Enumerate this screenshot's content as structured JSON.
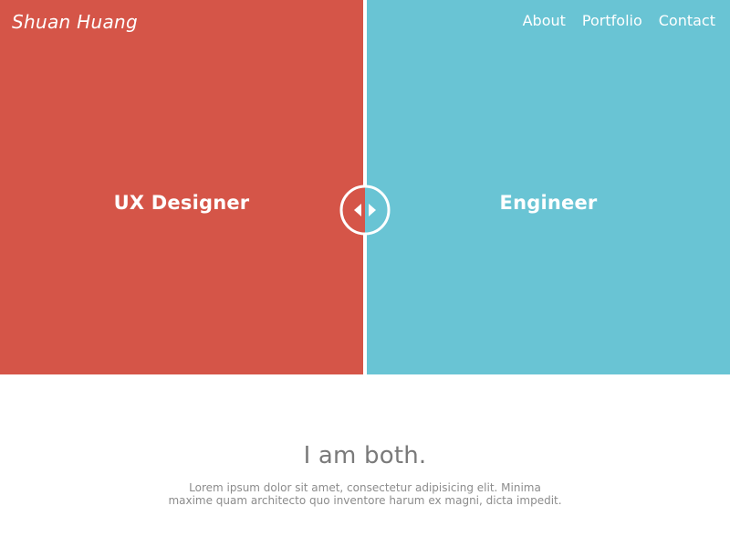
{
  "header": {
    "brand": "Shuan Huang",
    "nav": {
      "about": "About",
      "portfolio": "Portfolio",
      "contact": "Contact"
    }
  },
  "hero": {
    "left_title": "UX Designer",
    "right_title": "Engineer",
    "left_color": "#d55548",
    "right_color": "#69c4d4",
    "handle_icon": "left-right-arrows-icon"
  },
  "intro": {
    "headline": "I am both.",
    "body_line1": "Lorem ipsum dolor sit amet, consectetur adipisicing elit. Minima",
    "body_line2": "maxime quam architecto quo inventore harum ex magni, dicta impedit."
  }
}
